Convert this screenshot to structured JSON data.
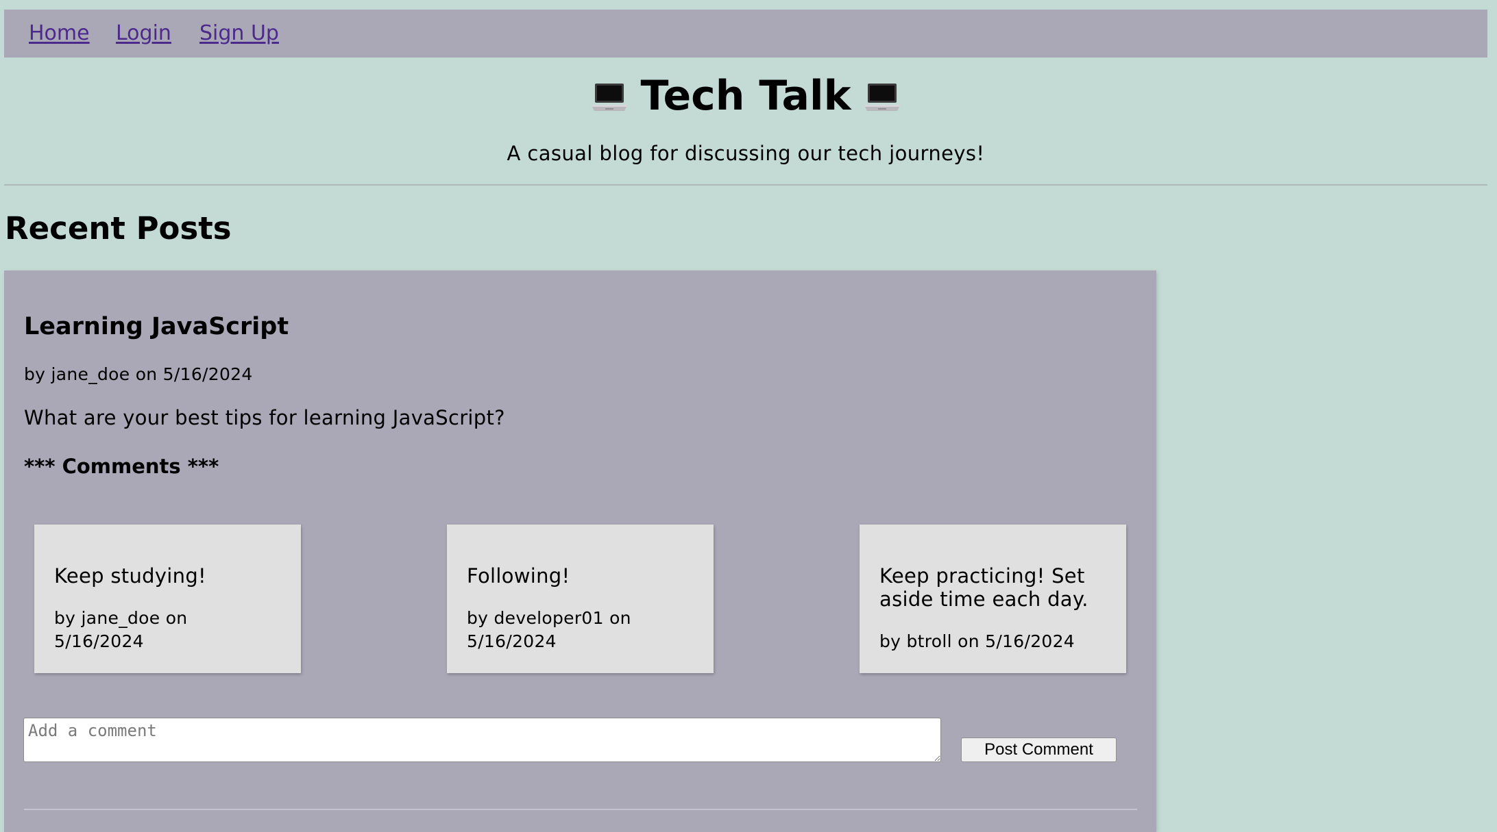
{
  "nav": {
    "links": [
      {
        "label": "Home"
      },
      {
        "label": "Login"
      },
      {
        "label": "Sign Up"
      }
    ]
  },
  "header": {
    "title": "Tech Talk",
    "tagline": "A casual blog for discussing our tech journeys!",
    "title_icon": "laptop-icon"
  },
  "main": {
    "section_heading": "Recent Posts",
    "posts": [
      {
        "title": "Learning JavaScript",
        "meta": "by jane_doe on 5/16/2024",
        "body": "What are your best tips for learning JavaScript?",
        "comments_heading": "*** Comments ***",
        "comments": [
          {
            "text": "Keep studying!",
            "meta": "by jane_doe on 5/16/2024"
          },
          {
            "text": "Following!",
            "meta": "by developer01 on 5/16/2024"
          },
          {
            "text": "Keep practicing! Set aside time each day.",
            "meta": "by btroll on 5/16/2024"
          }
        ],
        "comment_placeholder": "Add a comment",
        "comment_value": "",
        "post_comment_label": "Post Comment"
      }
    ]
  },
  "colors": {
    "page_background": "#c3dbd4",
    "nav_background": "#aaa7b7",
    "post_background": "#aaa7b7",
    "comment_background": "#e0e0e0",
    "link": "#4b2a8c"
  }
}
